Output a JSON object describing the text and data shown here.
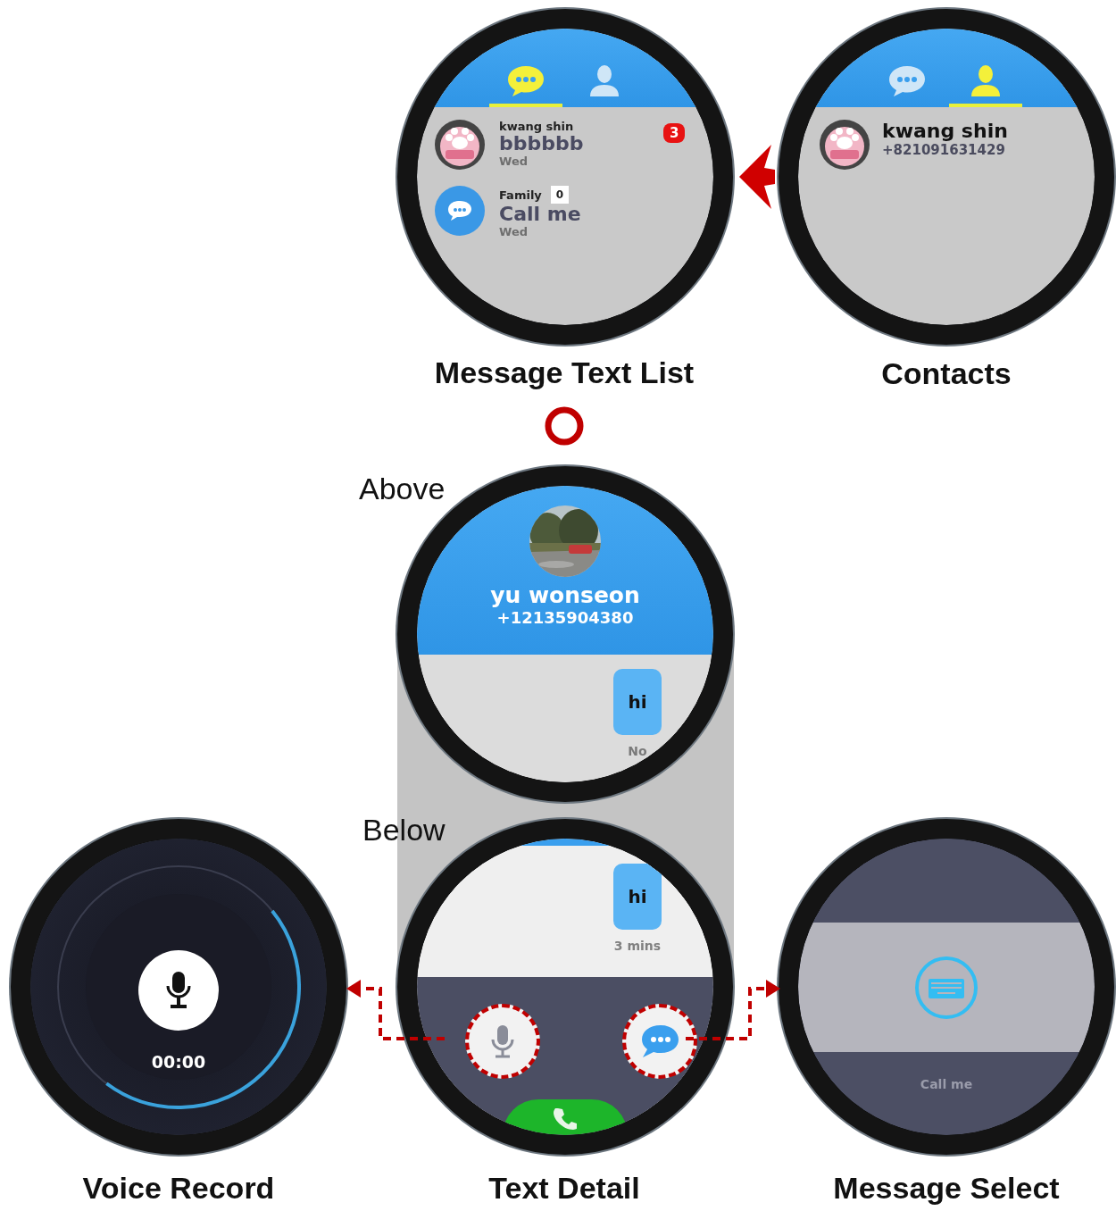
{
  "message_list": {
    "caption": "Message Text List",
    "tabs": [
      {
        "selected": true
      },
      {
        "selected": false
      }
    ],
    "threads": [
      {
        "kind": "avatar",
        "name": "kwang shin",
        "preview": "bbbbbb",
        "time": "Wed",
        "badge": "3"
      },
      {
        "kind": "group",
        "name": "Family",
        "preview": "Call me",
        "time": "Wed",
        "tag": "0"
      }
    ]
  },
  "contacts": {
    "caption": "Contacts",
    "tabs": [
      {
        "selected": false
      },
      {
        "selected": true
      }
    ],
    "items": [
      {
        "name": "kwang shin",
        "phone": "+821091631429"
      }
    ]
  },
  "text_detail": {
    "caption": "Text Detail",
    "above_label": "Above",
    "below_label": "Below",
    "contact_name": "yu wonseon",
    "phone": "+12135904380",
    "above_bubble": {
      "text": "hi",
      "time": "No"
    },
    "below_bubble": {
      "text": "hi",
      "time": "3 mins"
    }
  },
  "voice_record": {
    "caption": "Voice Record",
    "timer": "00:00"
  },
  "message_select": {
    "caption": "Message Select",
    "message": "Call me"
  }
}
